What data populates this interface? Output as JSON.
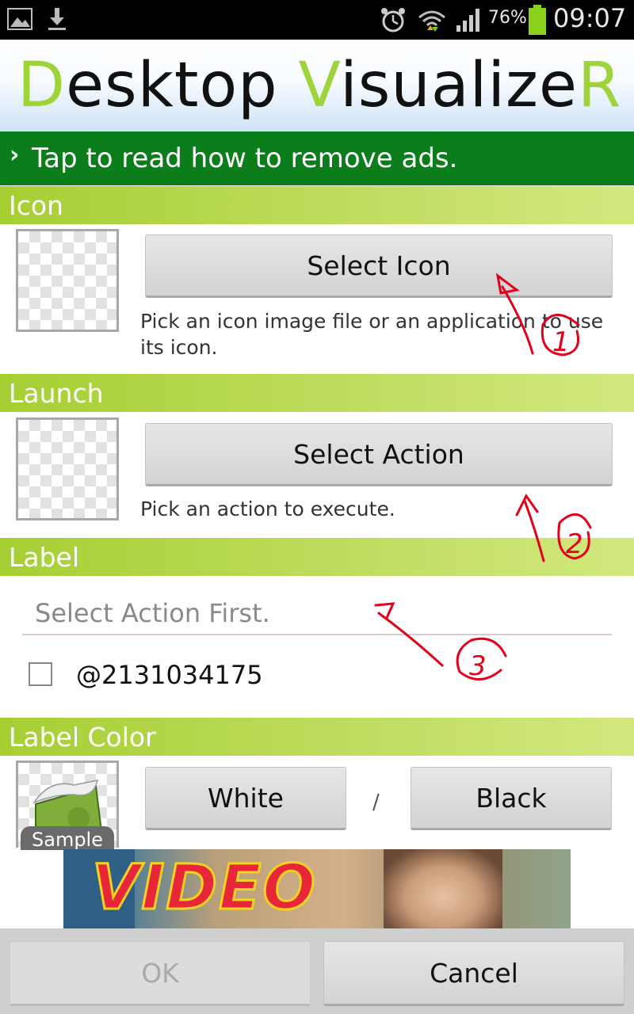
{
  "status_bar": {
    "battery_text": "76%",
    "time": "09:07",
    "icons": [
      "gallery-icon",
      "download-icon",
      "alarm-icon",
      "wifi-icon",
      "signal-icon",
      "battery-icon"
    ]
  },
  "banner": {
    "title_d": "D",
    "title_esktop": "esktop ",
    "title_v": "V",
    "title_isualize": "isualize",
    "title_r": "R"
  },
  "ad_bar": {
    "chevron": "›",
    "text": "Tap to read how to remove ads."
  },
  "sections": {
    "icon": {
      "header": "Icon",
      "button": "Select Icon",
      "description": "Pick an icon image file or an application to use its icon."
    },
    "launch": {
      "header": "Launch",
      "button": "Select Action",
      "description": "Pick an action to execute."
    },
    "label": {
      "header": "Label",
      "input_placeholder": "Select Action First.",
      "checkbox_label": "@2131034175"
    },
    "label_color": {
      "header": "Label Color",
      "sample_badge": "Sample",
      "white_button": "White",
      "separator": "/",
      "black_button": "Black"
    }
  },
  "ad": {
    "text": "VIDEO"
  },
  "footer": {
    "ok": "OK",
    "cancel": "Cancel"
  },
  "annotations": {
    "one": "1",
    "two": "2",
    "three": "3"
  },
  "colors": {
    "status_bar": "#000000",
    "ad_bar": "#0b7d1b",
    "section_header": "#a6cf33",
    "annotation": "#e3001b"
  }
}
